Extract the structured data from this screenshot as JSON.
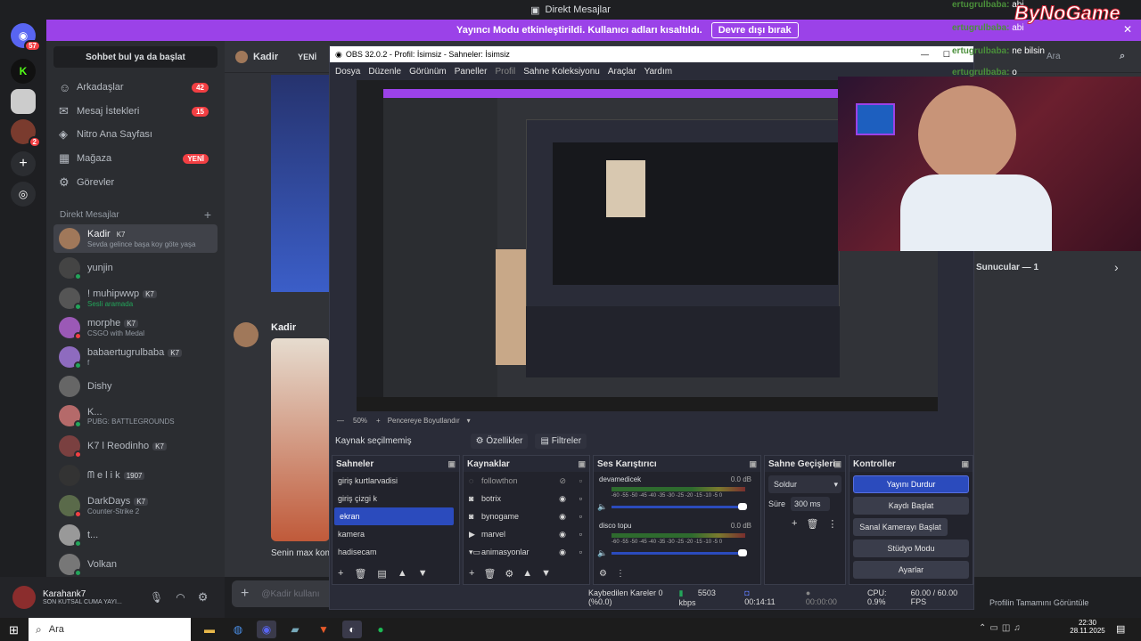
{
  "window_title": "Direkt Mesajlar",
  "banner": {
    "text": "Yayıncı Modu etkinleştirildi. Kullanıcı adları kısaltıldı.",
    "button": "Devre dışı bırak"
  },
  "servers": {
    "home_badge": "57",
    "badge2": "2"
  },
  "dm_sidebar": {
    "search": "Sohbet bul ya da başlat",
    "nav": [
      {
        "label": "Arkadaşlar",
        "badge": "42"
      },
      {
        "label": "Mesaj İstekleri",
        "badge": "15"
      },
      {
        "label": "Nitro Ana Sayfası",
        "badge": ""
      },
      {
        "label": "Mağaza",
        "badge": "YENİ"
      },
      {
        "label": "Görevler",
        "badge": ""
      }
    ],
    "section": "Direkt Mesajlar",
    "dms": [
      {
        "name": "Kadir",
        "tag": "K7",
        "sub": "Sevda gelince başa koy göte yaşa"
      },
      {
        "name": "yunjin",
        "tag": "",
        "sub": ""
      },
      {
        "name": "! muhipwwp",
        "tag": "K7",
        "sub": "Sesli aramada"
      },
      {
        "name": "morphe",
        "tag": "K7",
        "sub": "CSGO with Medal"
      },
      {
        "name": "babaertugrulbaba",
        "tag": "K7",
        "sub": "f"
      },
      {
        "name": "Dishy",
        "tag": "",
        "sub": ""
      },
      {
        "name": "K...",
        "tag": "",
        "sub": "PUBG: BATTLEGROUNDS"
      },
      {
        "name": "K7 l Reodinho",
        "tag": "K7",
        "sub": ""
      },
      {
        "name": "ᗰ e l i k",
        "tag": "1907",
        "sub": ""
      },
      {
        "name": "DarkDays",
        "tag": "K7",
        "sub": "Counter-Strike 2"
      },
      {
        "name": "t...",
        "tag": "",
        "sub": ""
      },
      {
        "name": "Volkan",
        "tag": "",
        "sub": ""
      }
    ]
  },
  "user_panel": {
    "name": "Karahank7",
    "status": "SON KUTSAL CUMA YAYI..."
  },
  "chat": {
    "header_name": "Kadir",
    "header_new": "YENİ",
    "msg_author": "Kadir",
    "msg_text": "Senin max kom",
    "input_placeholder": "@Kadir kullanı",
    "side_text": "Sunucular — 1",
    "search": "Ara"
  },
  "obs": {
    "title": "OBS 32.0.2 - Profil: İsimsiz - Sahneler: İsimsiz",
    "menu": [
      "Dosya",
      "Düzenle",
      "Görünüm",
      "Paneller",
      "Profil",
      "Sahne Koleksiyonu",
      "Araçlar",
      "Yardım"
    ],
    "zoom": "50%",
    "fit": "Pencereye Boyutlandır",
    "source_label": "Kaynak seçilmemiş",
    "props": "Özellikler",
    "filters": "Filtreler",
    "scenes_title": "Sahneler",
    "scenes": [
      "giriş kurtlarvadisi",
      "giriş çizgi k",
      "ekran",
      "kamera",
      "hadisecam"
    ],
    "sources_title": "Kaynaklar",
    "sources": [
      "followthon",
      "botrix",
      "bynogame",
      "marvel",
      "animasyonlar"
    ],
    "mixer_title": "Ses Karıştırıcı",
    "mixer": [
      {
        "name": "devamedicek",
        "db": "0.0 dB"
      },
      {
        "name": "disco topu",
        "db": "0.0 dB"
      }
    ],
    "mixer_scale": "-60 -55 -50 -45 -40 -35 -30 -25 -20 -15 -10 -5 0",
    "trans_title": "Sahne Geçişleri",
    "trans_type": "Soldur",
    "duration_label": "Süre",
    "duration": "300 ms",
    "controls_title": "Kontroller",
    "controls": [
      "Yayını Durdur",
      "Kaydı Başlat",
      "Sanal Kamerayı Başlat",
      "Stüdyo Modu",
      "Ayarlar"
    ],
    "status": {
      "dropped": "Kaybedilen Kareler 0 (%0.0)",
      "kbps": "5503 kbps",
      "live": "00:14:11",
      "rec": "00:00:00",
      "cpu": "CPU: 0.9%",
      "fps": "60.00 / 60.00 FPS"
    },
    "profile_text": "Profilin Tamamını Görüntüle"
  },
  "stream_chat": [
    {
      "user": "ertugrulbaba",
      "msg": "abi"
    },
    {
      "user": "ertugrulbaba",
      "msg": "ne bilsin"
    },
    {
      "user": "ertugrulbaba",
      "msg": "o"
    }
  ],
  "watermark": "ByNoGame",
  "taskbar": {
    "search": "Ara",
    "time": "22:30",
    "date": "28.11.2025"
  },
  "colors": {
    "accent": "#9b42e8",
    "obs_blue": "#2b4bbd",
    "discord_blurple": "#5865f2",
    "green": "#23a55a"
  }
}
